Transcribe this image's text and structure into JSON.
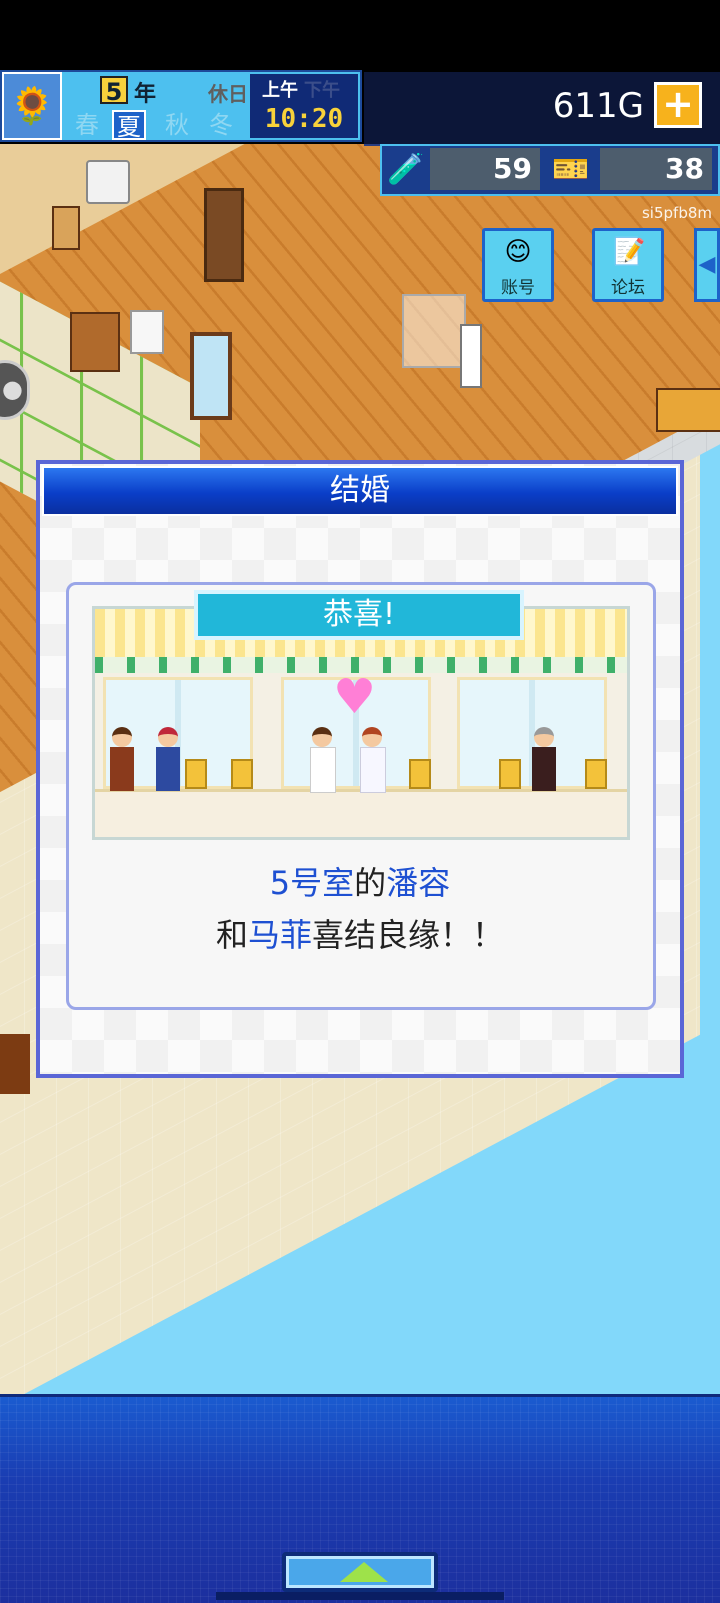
{
  "header": {
    "year_number": "5",
    "year_unit": "年",
    "holiday": "休日",
    "seasons": [
      "春",
      "夏",
      "秋",
      "冬"
    ],
    "active_season": "夏",
    "am": "上午",
    "pm": "下午",
    "time": "10:20",
    "money": "611G",
    "research_points": "59",
    "tickets": "38",
    "user_id": "si5pfb8m"
  },
  "side_buttons": {
    "account": "账号",
    "forum": "论坛"
  },
  "dialog": {
    "title": "结婚",
    "banner": "恭喜!",
    "line1": {
      "room": "5号室",
      "particle": "的",
      "name": "潘容"
    },
    "line2": {
      "prefix": "和",
      "name": "马菲",
      "suffix": "喜结良缘！！"
    }
  },
  "colors": {
    "highlight": "#1e50d2",
    "dialog_header": "#0a3ec8",
    "banner": "#21b7d9",
    "sky": "#82d8fa"
  },
  "icons": {
    "season_badge": "sunflower-icon",
    "money_add": "plus-icon",
    "research": "flask-icon",
    "tickets": "ticket-icon",
    "account": "smiley-icon",
    "forum": "memo-icon",
    "side_expand": "chevron-left-icon",
    "bottom_expand": "triangle-up-icon",
    "celebration": "heart-icon"
  }
}
